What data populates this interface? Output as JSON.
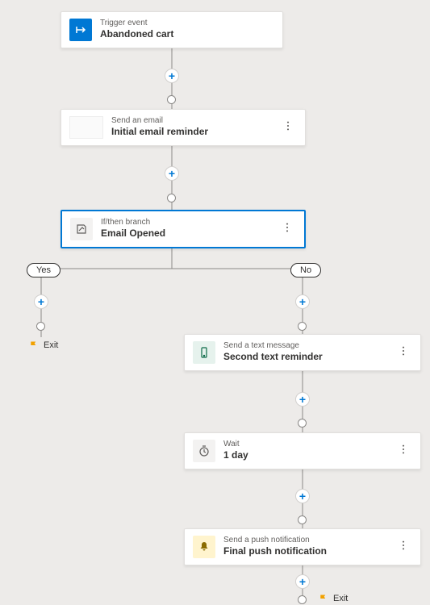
{
  "trigger": {
    "sub": "Trigger event",
    "main": "Abandoned cart"
  },
  "email": {
    "sub": "Send an email",
    "main": "Initial email reminder"
  },
  "branch": {
    "sub": "If/then branch",
    "main": "Email Opened",
    "yes": "Yes",
    "no": "No"
  },
  "sms": {
    "sub": "Send a text message",
    "main": "Second text reminder"
  },
  "wait": {
    "sub": "Wait",
    "main": "1 day"
  },
  "push": {
    "sub": "Send a push notification",
    "main": "Final push notification"
  },
  "exit": "Exit"
}
